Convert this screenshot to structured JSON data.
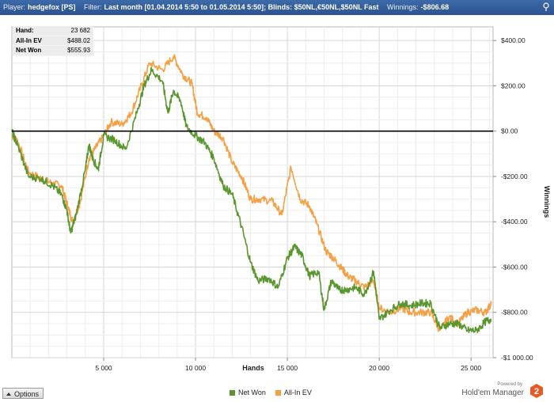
{
  "title_bar": {
    "player_label": "Player:",
    "player_value": "hedgefox [PS]",
    "filter_label": "Filter:",
    "filter_value": "Last month [01.04.2014 5:50 to 01.05.2014 5:50]; Blinds: $50NL,€50NL,$50NL Fast",
    "winnings_label": "Winnings:",
    "winnings_value": "-$806.68"
  },
  "stats": [
    {
      "label": "Hand:",
      "value": "23 682"
    },
    {
      "label": "All-In EV",
      "value": "$488.02"
    },
    {
      "label": "Net Won",
      "value": "$555.93"
    }
  ],
  "options": {
    "label": "Options"
  },
  "brand": {
    "powered": "Powered by",
    "name": "Hold'em Manager",
    "badge": "2"
  },
  "colors": {
    "net_won": "#5a962e",
    "allin_ev": "#f5a044",
    "title_bar": "#2f5a98",
    "zero_line": "#000000"
  },
  "chart_data": {
    "type": "line",
    "xlabel": "Hands",
    "ylabel": "Winnings",
    "xlim": [
      0,
      26200
    ],
    "ylim": [
      -1000,
      460
    ],
    "xticks": [
      5000,
      10000,
      15000,
      20000,
      25000
    ],
    "xtick_labels": [
      "5 000",
      "10 000",
      "15 000",
      "20 000",
      "25 000"
    ],
    "yticks": [
      400,
      200,
      0,
      -200,
      -400,
      -600,
      -800,
      -1000
    ],
    "ytick_labels": [
      "$400.00",
      "$200.00",
      "$0.00",
      "-$200.00",
      "-$400.00",
      "-$600.00",
      "-$800.00",
      "-$1 000.00"
    ],
    "grid": true,
    "legend_position": "bottom-center",
    "series": [
      {
        "name": "Net Won",
        "color": "#5a962e",
        "points": [
          [
            0,
            0
          ],
          [
            300,
            -60
          ],
          [
            900,
            -200
          ],
          [
            1600,
            -210
          ],
          [
            2200,
            -240
          ],
          [
            2700,
            -280
          ],
          [
            3000,
            -350
          ],
          [
            3200,
            -450
          ],
          [
            3500,
            -370
          ],
          [
            4000,
            -170
          ],
          [
            4200,
            -60
          ],
          [
            4400,
            -120
          ],
          [
            4700,
            -170
          ],
          [
            5000,
            -20
          ],
          [
            5600,
            -40
          ],
          [
            6200,
            -80
          ],
          [
            6800,
            80
          ],
          [
            7200,
            200
          ],
          [
            7600,
            270
          ],
          [
            8200,
            220
          ],
          [
            8500,
            80
          ],
          [
            8800,
            180
          ],
          [
            9200,
            130
          ],
          [
            9500,
            20
          ],
          [
            10000,
            -20
          ],
          [
            10500,
            -50
          ],
          [
            11000,
            -120
          ],
          [
            11500,
            -240
          ],
          [
            12000,
            -280
          ],
          [
            12500,
            -420
          ],
          [
            13000,
            -580
          ],
          [
            13400,
            -660
          ],
          [
            14000,
            -650
          ],
          [
            14500,
            -690
          ],
          [
            15000,
            -560
          ],
          [
            15400,
            -510
          ],
          [
            15800,
            -550
          ],
          [
            16200,
            -640
          ],
          [
            16700,
            -620
          ],
          [
            17000,
            -790
          ],
          [
            17400,
            -660
          ],
          [
            17800,
            -700
          ],
          [
            18200,
            -700
          ],
          [
            18700,
            -690
          ],
          [
            19200,
            -720
          ],
          [
            19700,
            -620
          ],
          [
            20000,
            -830
          ],
          [
            20600,
            -790
          ],
          [
            21200,
            -760
          ],
          [
            21700,
            -770
          ],
          [
            22300,
            -760
          ],
          [
            22800,
            -760
          ],
          [
            23300,
            -870
          ],
          [
            23800,
            -850
          ],
          [
            24300,
            -850
          ],
          [
            24800,
            -880
          ],
          [
            25300,
            -880
          ],
          [
            25800,
            -840
          ],
          [
            26100,
            -830
          ]
        ]
      },
      {
        "name": "All-In EV",
        "color": "#f5a044",
        "points": [
          [
            0,
            -20
          ],
          [
            300,
            -40
          ],
          [
            900,
            -180
          ],
          [
            1600,
            -210
          ],
          [
            2200,
            -230
          ],
          [
            2700,
            -240
          ],
          [
            3000,
            -320
          ],
          [
            3300,
            -400
          ],
          [
            3700,
            -320
          ],
          [
            4200,
            -120
          ],
          [
            4600,
            -70
          ],
          [
            5000,
            -20
          ],
          [
            5400,
            40
          ],
          [
            6000,
            30
          ],
          [
            6500,
            80
          ],
          [
            7000,
            190
          ],
          [
            7500,
            300
          ],
          [
            8200,
            270
          ],
          [
            8800,
            330
          ],
          [
            9300,
            250
          ],
          [
            9800,
            210
          ],
          [
            10100,
            80
          ],
          [
            10600,
            60
          ],
          [
            11000,
            0
          ],
          [
            11500,
            -30
          ],
          [
            12000,
            -140
          ],
          [
            12500,
            -200
          ],
          [
            13000,
            -300
          ],
          [
            13500,
            -300
          ],
          [
            14200,
            -310
          ],
          [
            14700,
            -370
          ],
          [
            15200,
            -160
          ],
          [
            15700,
            -300
          ],
          [
            16200,
            -330
          ],
          [
            16600,
            -410
          ],
          [
            17100,
            -530
          ],
          [
            17500,
            -560
          ],
          [
            17900,
            -600
          ],
          [
            18300,
            -640
          ],
          [
            18700,
            -660
          ],
          [
            19200,
            -690
          ],
          [
            19700,
            -660
          ],
          [
            20000,
            -780
          ],
          [
            20600,
            -800
          ],
          [
            21200,
            -780
          ],
          [
            21700,
            -800
          ],
          [
            22300,
            -800
          ],
          [
            22800,
            -800
          ],
          [
            23300,
            -880
          ],
          [
            23800,
            -820
          ],
          [
            24300,
            -850
          ],
          [
            24800,
            -800
          ],
          [
            25300,
            -790
          ],
          [
            25800,
            -800
          ],
          [
            26100,
            -760
          ]
        ]
      }
    ]
  }
}
